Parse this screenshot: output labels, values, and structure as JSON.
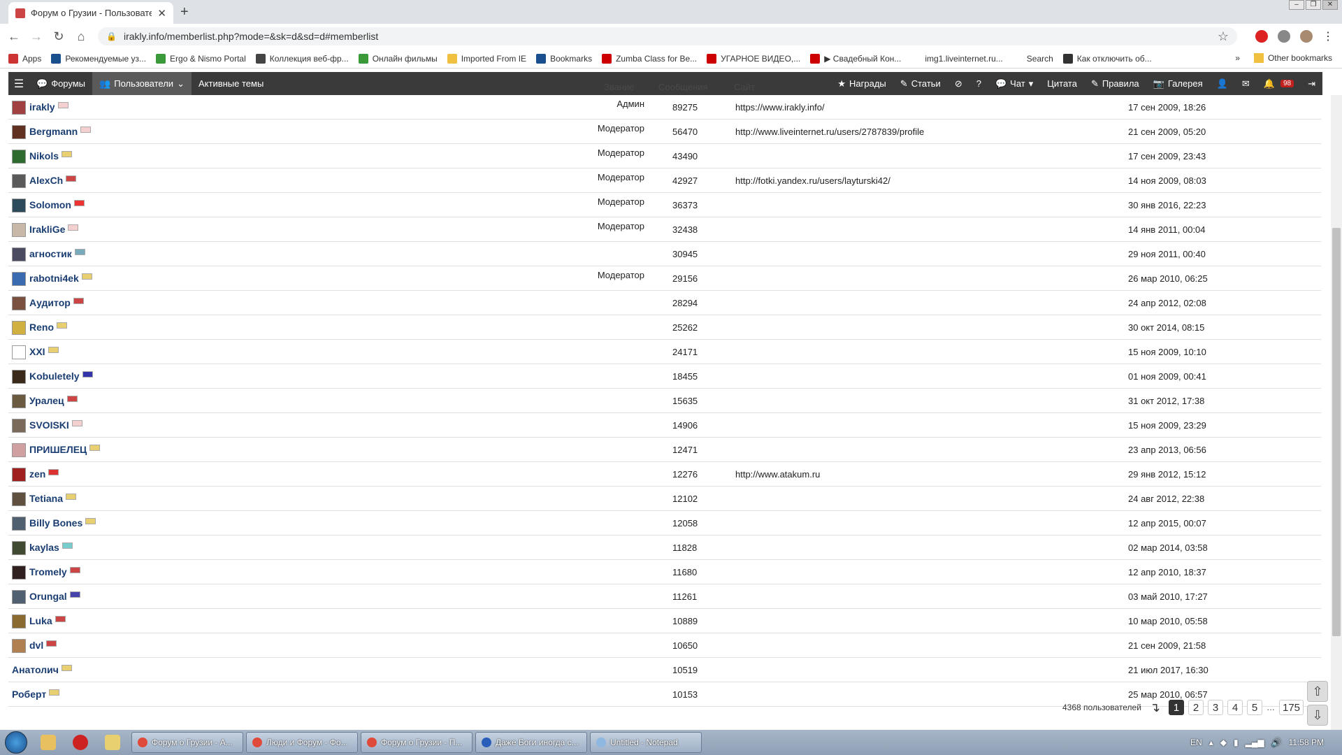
{
  "browser": {
    "tab_title": "Форум о Грузии - Пользовател...",
    "url": "irakly.info/memberlist.php?mode=&sk=d&sd=d#memberlist",
    "bookmarks": [
      "Apps",
      "Рекомендуемые уз...",
      "Ergo & Nismo Portal",
      "Коллекция веб-фр...",
      "Онлайн фильмы",
      "Imported From IE",
      "Bookmarks",
      "Zumba Class for Be...",
      "УГАРНОЕ ВИДЕО,...",
      "▶ Свадебный Кон...",
      "img1.liveinternet.ru...",
      "Search",
      "Как отключить об..."
    ],
    "bookmarks_more": "»",
    "other_bookmarks": "Other bookmarks"
  },
  "forumnav": {
    "left": [
      "Форумы",
      "Пользователи",
      "Активные темы"
    ],
    "right": [
      "Награды",
      "Статьи",
      "Чат",
      "Цитата",
      "Правила",
      "Галерея"
    ],
    "notif_count": "98"
  },
  "headers": {
    "rank": "Звание",
    "posts": "Сообщения",
    "site": "Сайт"
  },
  "members": [
    {
      "name": "irakly",
      "rank": "Админ",
      "posts": "89275",
      "site": "https://www.irakly.info/",
      "joined": "17 сен 2009, 18:26"
    },
    {
      "name": "Bergmann",
      "rank": "Модератор",
      "posts": "56470",
      "site": "http://www.liveinternet.ru/users/2787839/profile",
      "joined": "21 сен 2009, 05:20"
    },
    {
      "name": "Nikols",
      "rank": "Модератор",
      "posts": "43490",
      "site": "",
      "joined": "17 сен 2009, 23:43"
    },
    {
      "name": "AlexCh",
      "rank": "Модератор",
      "posts": "42927",
      "site": "http://fotki.yandex.ru/users/layturski42/",
      "joined": "14 ноя 2009, 08:03"
    },
    {
      "name": "Solomon",
      "rank": "Модератор",
      "posts": "36373",
      "site": "",
      "joined": "30 янв 2016, 22:23"
    },
    {
      "name": "IrakliGe",
      "rank": "Модератор",
      "posts": "32438",
      "site": "",
      "joined": "14 янв 2011, 00:04"
    },
    {
      "name": "агностик",
      "rank": "",
      "posts": "30945",
      "site": "",
      "joined": "29 ноя 2011, 00:40"
    },
    {
      "name": "rabotni4ek",
      "rank": "Модератор",
      "posts": "29156",
      "site": "",
      "joined": "26 мар 2010, 06:25"
    },
    {
      "name": "Аудитор",
      "rank": "",
      "posts": "28294",
      "site": "",
      "joined": "24 апр 2012, 02:08"
    },
    {
      "name": "Reno",
      "rank": "",
      "posts": "25262",
      "site": "",
      "joined": "30 окт 2014, 08:15"
    },
    {
      "name": "XXI",
      "rank": "",
      "posts": "24171",
      "site": "",
      "joined": "15 ноя 2009, 10:10"
    },
    {
      "name": "Kobuletely",
      "rank": "",
      "posts": "18455",
      "site": "",
      "joined": "01 ноя 2009, 00:41"
    },
    {
      "name": "Уралец",
      "rank": "",
      "posts": "15635",
      "site": "",
      "joined": "31 окт 2012, 17:38"
    },
    {
      "name": "SVOISKI",
      "rank": "",
      "posts": "14906",
      "site": "",
      "joined": "15 ноя 2009, 23:29"
    },
    {
      "name": "ПРИШЕЛЕЦ",
      "rank": "",
      "posts": "12471",
      "site": "",
      "joined": "23 апр 2013, 06:56"
    },
    {
      "name": "zen",
      "rank": "",
      "posts": "12276",
      "site": "http://www.atakum.ru",
      "joined": "29 янв 2012, 15:12"
    },
    {
      "name": "Tetiana",
      "rank": "",
      "posts": "12102",
      "site": "",
      "joined": "24 авг 2012, 22:38"
    },
    {
      "name": "Billy Bones",
      "rank": "",
      "posts": "12058",
      "site": "",
      "joined": "12 апр 2015, 00:07"
    },
    {
      "name": "kaylas",
      "rank": "",
      "posts": "11828",
      "site": "",
      "joined": "02 мар 2014, 03:58"
    },
    {
      "name": "Tromely",
      "rank": "",
      "posts": "11680",
      "site": "",
      "joined": "12 апр 2010, 18:37"
    },
    {
      "name": "Orungal",
      "rank": "",
      "posts": "11261",
      "site": "",
      "joined": "03 май 2010, 17:27"
    },
    {
      "name": "Luka",
      "rank": "",
      "posts": "10889",
      "site": "",
      "joined": "10 мар 2010, 05:58"
    },
    {
      "name": "dvl",
      "rank": "",
      "posts": "10650",
      "site": "",
      "joined": "21 сен 2009, 21:58"
    },
    {
      "name": "Анатолич",
      "rank": "",
      "posts": "10519",
      "site": "",
      "joined": "21 июл 2017, 16:30"
    },
    {
      "name": "Роберт",
      "rank": "",
      "posts": "10153",
      "site": "",
      "joined": "25 мар 2010, 06:57"
    }
  ],
  "pagination": {
    "total": "4368 пользователей",
    "pages": [
      "1",
      "2",
      "3",
      "4",
      "5"
    ],
    "ellipsis": "…",
    "last": "175"
  },
  "taskbar": {
    "items": [
      "Форум о Грузии - А...",
      "Люди и Форум - Фо...",
      "Форум о Грузии - П...",
      "Даже Боги иногда с...",
      "Untitled - Notepad"
    ],
    "lang": "EN",
    "clock": "11:58 PM"
  }
}
